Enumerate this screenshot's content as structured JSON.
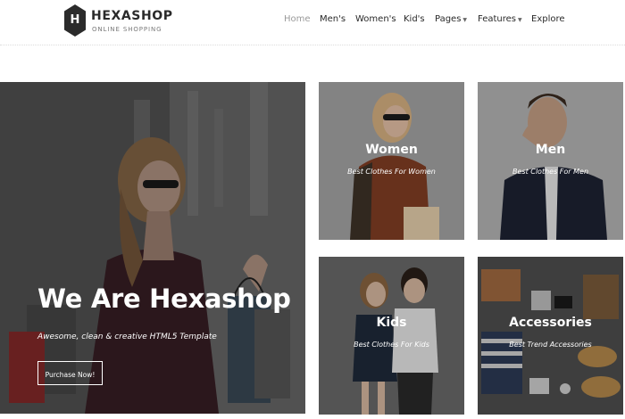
{
  "brand": {
    "logo_letter": "H",
    "name": "HEXASHOP",
    "tagline": "ONLINE SHOPPING"
  },
  "nav": {
    "items": [
      {
        "label": "Home",
        "active": true
      },
      {
        "label": "Men's"
      },
      {
        "label": "Women's"
      },
      {
        "label": "Kid's"
      },
      {
        "label": "Pages",
        "dropdown": true
      },
      {
        "label": "Features",
        "dropdown": true
      },
      {
        "label": "Explore"
      }
    ]
  },
  "hero": {
    "title": "We Are Hexashop",
    "subtitle": "Awesome, clean & creative HTML5 Template",
    "button_label": "Purchase Now!"
  },
  "categories": [
    {
      "title": "Women",
      "subtitle": "Best Clothes For Women"
    },
    {
      "title": "Men",
      "subtitle": "Best Clothes For Men"
    },
    {
      "title": "Kids",
      "subtitle": "Best Clothes For Kids"
    },
    {
      "title": "Accessories",
      "subtitle": "Best Trend Accessories"
    }
  ],
  "colors": {
    "text_dark": "#2a2a2a",
    "nav_active": "#9a9a9a",
    "overlay_text": "#ffffff"
  }
}
